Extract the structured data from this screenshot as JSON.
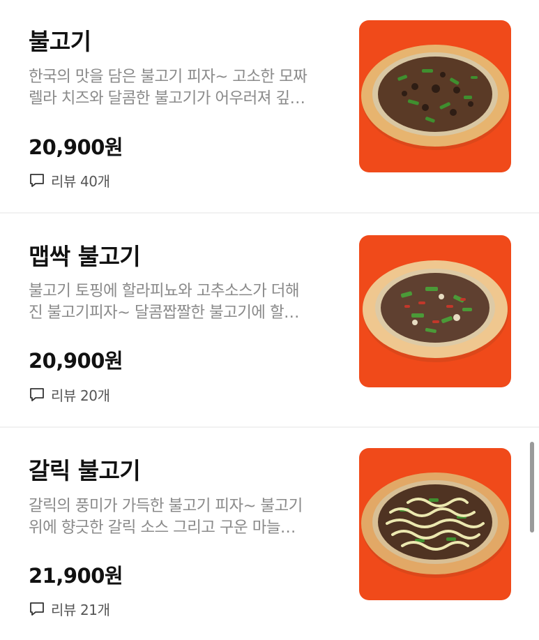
{
  "menu_items": [
    {
      "name": "불고기",
      "description_line1": "한국의 맛을 담은 불고기 피자~ 고소한 모짜",
      "description_line2": "렐라 치즈와 달콤한 불고기가 어우러져 깊…",
      "price": "20,900원",
      "reviews": "리뷰 40개",
      "image_icon": "pizza-bulgogi"
    },
    {
      "name": "맵싹 불고기",
      "description_line1": "불고기 토핑에 할라피뇨와 고추소스가 더해",
      "description_line2": "진 불고기피자~ 달콤짭짤한 불고기에 할…",
      "price": "20,900원",
      "reviews": "리뷰 20개",
      "image_icon": "pizza-spicy-bulgogi"
    },
    {
      "name": "갈릭 불고기",
      "description_line1": "갈릭의 풍미가 가득한 불고기 피자~ 불고기",
      "description_line2": "위에 향긋한 갈릭 소스 그리고 구운 마늘…",
      "price": "21,900원",
      "reviews": "리뷰 21개",
      "image_icon": "pizza-garlic-bulgogi"
    }
  ],
  "colors": {
    "image_background": "#f04a1a",
    "crust": "#e9b977",
    "meat": "#4a2f22",
    "pepper": "#3f8f2f",
    "garlic_sauce": "#e8e4a8"
  }
}
